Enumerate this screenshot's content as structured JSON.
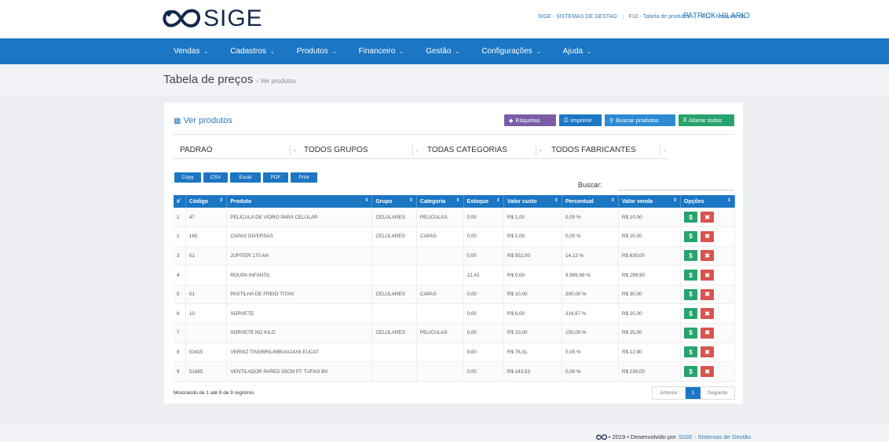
{
  "brand": {
    "name": "SIGE"
  },
  "header": {
    "links": [
      "SIGE - SISTEMAS DE GESTAO",
      "F10 - Tabela de produtos",
      "F12 - Nova venda"
    ],
    "user": "PATRICK HILARIO"
  },
  "nav": {
    "items": [
      "Vendas",
      "Cadastros",
      "Produtos",
      "Financeiro",
      "Gestão",
      "Configurações",
      "Ajuda"
    ]
  },
  "breadcrumb": {
    "title": "Tabela de preços",
    "sep": "›",
    "sub": "Ver produtos"
  },
  "card": {
    "title": "Ver produtos",
    "buttons": {
      "etiquetas": "Etiquetas",
      "imprimir": "Imprimir",
      "buscar": "Buscar produtos",
      "alterar": "Alterar todos"
    },
    "filters": [
      "PADRAO",
      "TODOS GRUPOS",
      "TODAS CATEGORIAS",
      "TODOS FABRICANTES"
    ],
    "export": [
      "Copy",
      "CSV",
      "Excel",
      "PDF",
      "Print"
    ],
    "search_label": "Buscar:",
    "columns": [
      "#",
      "Código",
      "Produto",
      "Grupo",
      "Categoria",
      "Estoque",
      "Valor custo",
      "Percentual",
      "Valor venda",
      "Opções"
    ],
    "rows": [
      [
        "1",
        "47",
        "PELICULA DE VIDRO PARA CELULAR",
        "CELULARES",
        "PELICULAS",
        "0,00",
        "R$ 1,00",
        "0,00 %",
        "R$ 10,00"
      ],
      [
        "2",
        "185",
        "CAPAS DIVERSAS",
        "CELULARES",
        "CAPAS",
        "0,00",
        "R$ 5,00",
        "0,00 %",
        "R$ 20,00"
      ],
      [
        "3",
        "01",
        "JUPITER 170 AH",
        "",
        "",
        "0,00",
        "R$ 552,00",
        "14,13 %",
        "R$ 630,00"
      ],
      [
        "4",
        "",
        "ROUPA INFANTIL",
        "",
        "",
        "12,43",
        "R$ 0,00",
        "9.999,99 %",
        "R$ 299,90"
      ],
      [
        "5",
        "01",
        "PASTILHA DE FREIO TITAN",
        "CELULARES",
        "CAPAS",
        "0,00",
        "R$ 10,00",
        "200,00 %",
        "R$ 30,00"
      ],
      [
        "6",
        "10",
        "SORVETE",
        "",
        "",
        "0,00",
        "R$ 6,00",
        "316,67 %",
        "R$ 25,00"
      ],
      [
        "7",
        "",
        "SORVETE NO KILO",
        "CELULARES",
        "PELICULAS",
        "0,00",
        "R$ 10,00",
        "150,00 %",
        "R$ 25,00"
      ],
      [
        "8",
        "03415",
        "VERNIZ TINGBRILIMBUIA14X6 EUCAT",
        "",
        "",
        "9,00",
        "R$ 76,31",
        "0,00 %",
        "R$ 12,90"
      ],
      [
        "9",
        "51685",
        "VENTILADOR PARED 50CM PT TUFAO BV",
        "",
        "",
        "0,00",
        "R$ 143,53",
        "0,00 %",
        "R$ 230,00"
      ]
    ],
    "info": "Mostrando de 1 até 9 de 9 registros",
    "pagination": {
      "prev": "Anterior",
      "current": "1",
      "next": "Seguinte"
    }
  },
  "footer": {
    "text": "• 2019 • Desenvolvido por",
    "link": "SIGE - Sistemas de Gestão"
  },
  "colors": {
    "primary": "#1b76c3",
    "success": "#27a36e",
    "danger": "#d9534f",
    "purple": "#7b5ca8"
  }
}
